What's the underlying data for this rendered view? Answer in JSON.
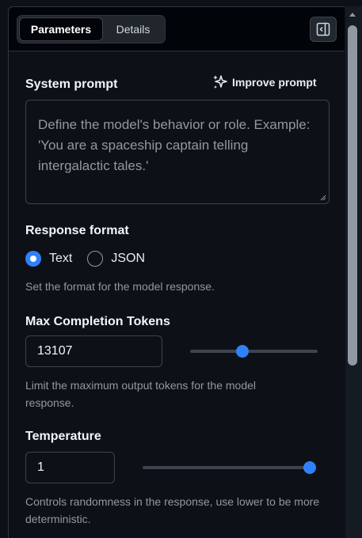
{
  "tabs": [
    {
      "label": "Parameters",
      "active": true
    },
    {
      "label": "Details",
      "active": false
    }
  ],
  "header": {
    "panel_toggle_icon": "sidebar-collapse-icon"
  },
  "system_prompt": {
    "title": "System prompt",
    "improve_label": "Improve prompt",
    "improve_icon": "sparkles-icon",
    "placeholder": "Define the model's behavior or role. Example: 'You are a spaceship captain telling intergalactic tales.'",
    "value": ""
  },
  "response_format": {
    "title": "Response format",
    "options": [
      {
        "label": "Text",
        "checked": true
      },
      {
        "label": "JSON",
        "checked": false
      }
    ],
    "help": "Set the format for the model response."
  },
  "max_tokens": {
    "title": "Max Completion Tokens",
    "value": "13107",
    "slider_fraction": 0.41,
    "help": "Limit the maximum output tokens for the model response."
  },
  "temperature": {
    "title": "Temperature",
    "value": "1",
    "slider_fraction": 1.0,
    "help": "Controls randomness in the response, use lower to be more deterministic."
  },
  "colors": {
    "accent": "#2f81f7",
    "background": "#0d1117",
    "border": "#3d444d",
    "muted_text": "#9198a1"
  }
}
